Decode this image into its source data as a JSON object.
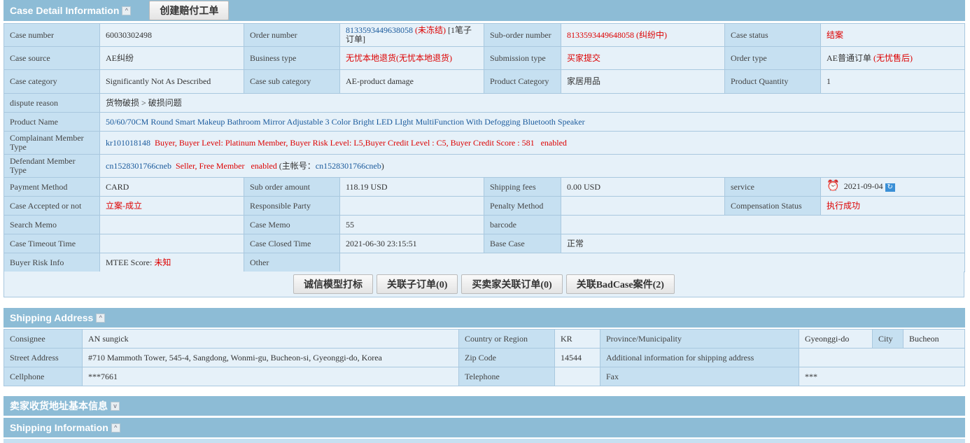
{
  "case": {
    "title": "Case Detail Information",
    "create_btn": "创建赔付工单",
    "rows": {
      "case_number": {
        "l": "Case number",
        "v": "60030302498"
      },
      "order_number": {
        "l": "Order number",
        "v": "8133593449638058",
        "s": "(未冻结)",
        "x": "[1笔子订单]"
      },
      "sub_order": {
        "l": "Sub-order number",
        "v": "8133593449648058",
        "s": "(纠纷中)"
      },
      "case_status": {
        "l": "Case status",
        "v": "结案"
      },
      "case_source": {
        "l": "Case source",
        "v": "AE纠纷"
      },
      "business_type": {
        "l": "Business type",
        "v": "无忧本地退货(无忧本地退货)"
      },
      "submission_type": {
        "l": "Submission type",
        "v": "买家提交"
      },
      "order_type": {
        "l": "Order type",
        "v": "AE普通订单",
        "s": "(无忧售后)"
      },
      "case_category": {
        "l": "Case category",
        "v": "Significantly Not As Described"
      },
      "case_sub_category": {
        "l": "Case sub category",
        "v": "AE-product damage"
      },
      "product_category": {
        "l": "Product Category",
        "v": "家居用品"
      },
      "product_quantity": {
        "l": "Product Quantity",
        "v": "1"
      },
      "dispute_reason": {
        "l": "dispute reason",
        "v": "货物破损 > 破损问题"
      },
      "product_name": {
        "l": "Product Name",
        "v": "50/60/70CM Round Smart Makeup Bathroom Mirror Adjustable 3 Color Bright LED LIght MultiFunction With Defogging Bluetooth Speaker"
      },
      "complainant": {
        "l": "Complainant Member Type",
        "id": "kr101018148",
        "v": "Buyer, Buyer Level: Platinum Member, Buyer Risk Level: L5,Buyer Credit Level : C5, Buyer Credit Score : 581",
        "st": "enabled"
      },
      "defendant": {
        "l": "Defendant Member Type",
        "id": "cn1528301766cneb",
        "v": "Seller, Free Member",
        "st": "enabled",
        "main_label": "(主帐号：",
        "main_id": "cn1528301766cneb",
        "close": ")"
      },
      "payment_method": {
        "l": "Payment Method",
        "v": "CARD"
      },
      "sub_order_amount": {
        "l": "Sub order amount",
        "v": "118.19 USD"
      },
      "shipping_fees": {
        "l": "Shipping fees",
        "v": "0.00 USD"
      },
      "service": {
        "l": "service",
        "v": "2021-09-04"
      },
      "case_accepted": {
        "l": "Case Accepted or not",
        "v": "立案-成立"
      },
      "responsible_party": {
        "l": "Responsible Party",
        "v": ""
      },
      "penalty_method": {
        "l": "Penalty Method",
        "v": ""
      },
      "compensation_status": {
        "l": "Compensation Status",
        "v": "执行成功"
      },
      "search_memo": {
        "l": "Search Memo",
        "v": ""
      },
      "case_memo": {
        "l": "Case Memo",
        "v": "55"
      },
      "barcode": {
        "l": "barcode",
        "v": ""
      },
      "case_timeout": {
        "l": "Case Timeout Time",
        "v": ""
      },
      "case_closed": {
        "l": "Case Closed Time",
        "v": "2021-06-30 23:15:51"
      },
      "base_case": {
        "l": "Base Case",
        "v": "正常"
      },
      "buyer_risk": {
        "l": "Buyer Risk Info",
        "k": "MTEE Score:",
        "v": "未知"
      },
      "other": {
        "l": "Other",
        "v": ""
      }
    },
    "buttons": [
      "诚信模型打标",
      "关联子订单(0)",
      "买卖家关联订单(0)",
      "关联BadCase案件(2)"
    ]
  },
  "shipping_address": {
    "title": "Shipping Address",
    "consignee": {
      "l": "Consignee",
      "v": "AN sungick"
    },
    "country": {
      "l": "Country or Region",
      "v": "KR"
    },
    "province": {
      "l": "Province/Municipality",
      "v": "Gyeonggi-do"
    },
    "city": {
      "l": "City",
      "v": "Bucheon"
    },
    "street": {
      "l": "Street Address",
      "v": "#710 Mammoth Tower, 545-4, Sangdong, Wonmi-gu, Bucheon-si, Gyeonggi-do, Korea"
    },
    "zip": {
      "l": "Zip Code",
      "v": "14544"
    },
    "additional": {
      "l": "Additional information for shipping address",
      "v": ""
    },
    "cellphone": {
      "l": "Cellphone",
      "v": "***7661"
    },
    "telephone": {
      "l": "Telephone",
      "v": ""
    },
    "fax": {
      "l": "Fax",
      "v": "***"
    }
  },
  "seller_address": {
    "title": "卖家收货地址基本信息"
  },
  "shipping_info": {
    "title": "Shipping Information"
  },
  "colors": {
    "header": "#8dbcd6",
    "label": "#c6e0f1",
    "value": "#e6f1f9",
    "red": "#dd0000",
    "link": "#1a5a9c"
  }
}
